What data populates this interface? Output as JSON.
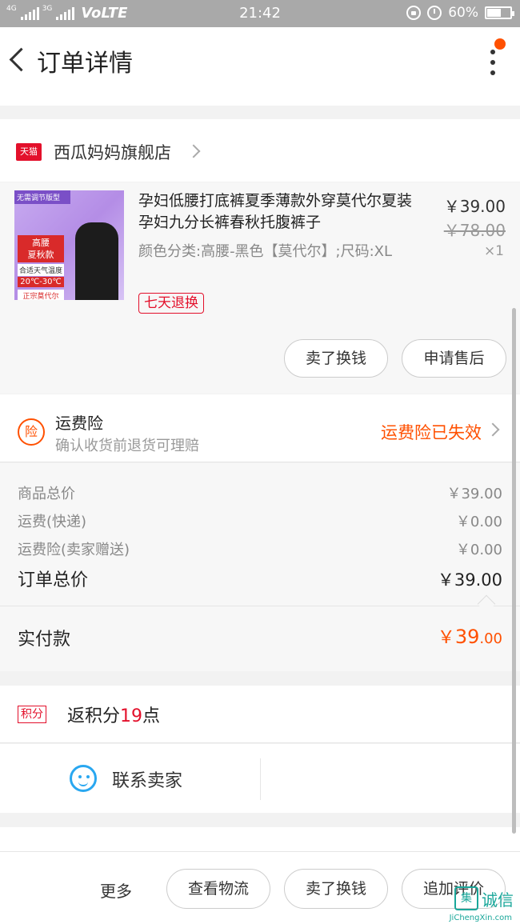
{
  "status_bar": {
    "signal_label_1": "4G",
    "signal_label_2": "3G",
    "network": "VoLTE",
    "time": "21:42",
    "battery_text": "60%",
    "battery_level": 0.6
  },
  "header": {
    "title": "订单详情",
    "notification_color": "#ff5000"
  },
  "store": {
    "badge": "天猫",
    "name": "西瓜妈妈旗舰店"
  },
  "product": {
    "image_texts": {
      "top_tag": "无需调节版型",
      "badge": "高腰\n夏秋款",
      "note": "合适天气温度",
      "temp": "20℃-30℃",
      "bottom_tag": "正宗莫代尔"
    },
    "title": "孕妇低腰打底裤夏季薄款外穿莫代尔夏装孕妇九分长裤春秋托腹裤子",
    "sku": "颜色分类:高腰-黑色【莫代尔】;尺码:XL",
    "return_tag": "七天退换",
    "price": "￥39.00",
    "original_price": "￥78.00",
    "quantity": "×1",
    "actions": [
      "卖了换钱",
      "申请售后"
    ]
  },
  "insurance": {
    "icon_text": "险",
    "title": "运费险",
    "subtitle": "确认收货前退货可理赔",
    "status": "运费险已失效"
  },
  "totals": {
    "rows": [
      {
        "label": "商品总价",
        "value": "￥39.00"
      },
      {
        "label": "运费(快递)",
        "value": "￥0.00"
      },
      {
        "label": "运费险(卖家赠送)",
        "value": "￥0.00"
      }
    ],
    "order_total_label": "订单总价",
    "order_total_value": "￥39.00",
    "paid_label": "实付款",
    "paid_symbol": "￥",
    "paid_integer": "39",
    "paid_decimal": ".00"
  },
  "points": {
    "badge": "积分",
    "prefix": "返积分",
    "number": "19",
    "suffix": "点"
  },
  "contact": {
    "label": "联系卖家"
  },
  "bottom_bar": {
    "more": "更多",
    "buttons": [
      "查看物流",
      "卖了换钱",
      "追加评价"
    ]
  },
  "watermark": {
    "logo": "集",
    "text": "诚信",
    "url": "JiChengXin.com"
  },
  "colors": {
    "accent": "#ff5000",
    "tmall_red": "#e3102b",
    "contact_blue": "#29a7f0"
  }
}
